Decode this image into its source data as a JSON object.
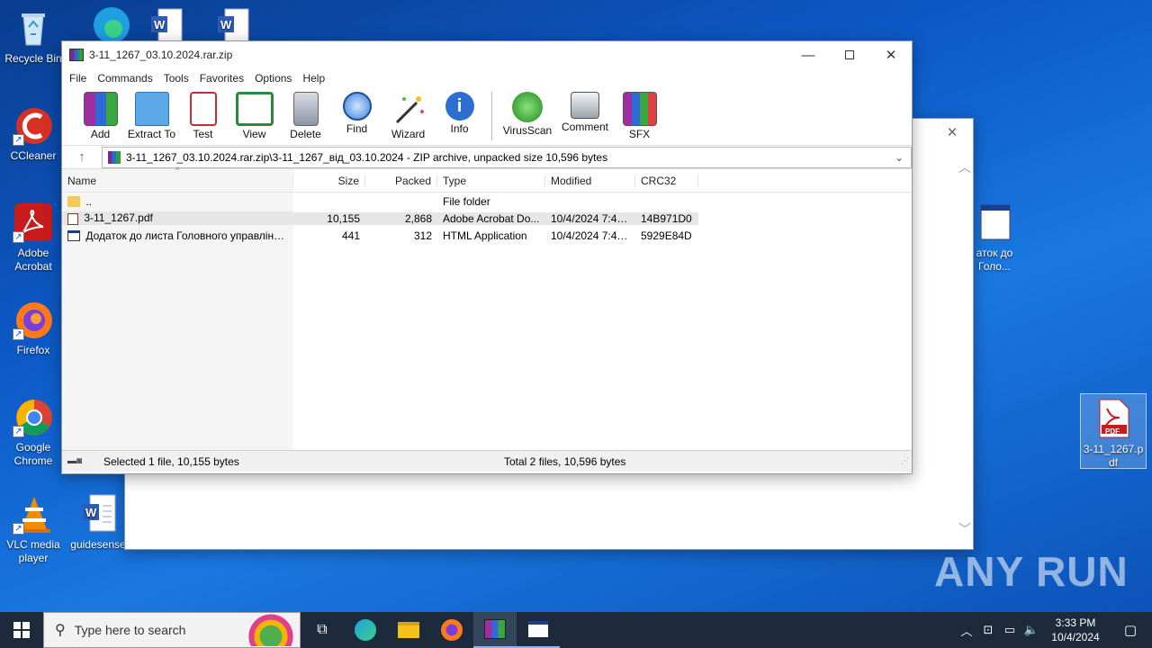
{
  "desktop": {
    "icons": [
      {
        "label": "Recycle Bin"
      },
      {
        "label": "CCleaner"
      },
      {
        "label": "Adobe Acrobat"
      },
      {
        "label": "Firefox"
      },
      {
        "label": "Google Chrome"
      },
      {
        "label": "VLC media player"
      },
      {
        "label": "guidesense"
      },
      {
        "label": "3-11_1267.pdf"
      },
      {
        "label": "аток до Голо..."
      }
    ],
    "pdf_icon_text": "PDF"
  },
  "bg_window": {
    "close_glyph": "✕"
  },
  "winrar": {
    "title": "3-11_1267_03.10.2024.rar.zip",
    "menu": [
      "File",
      "Commands",
      "Tools",
      "Favorites",
      "Options",
      "Help"
    ],
    "toolbar": [
      "Add",
      "Extract To",
      "Test",
      "View",
      "Delete",
      "Find",
      "Wizard",
      "Info",
      "VirusScan",
      "Comment",
      "SFX"
    ],
    "address": "3-11_1267_03.10.2024.rar.zip\\3-11_1267_від_03.10.2024 - ZIP archive, unpacked size 10,596 bytes",
    "columns": {
      "name": "Name",
      "size": "Size",
      "packed": "Packed",
      "type": "Type",
      "modified": "Modified",
      "crc": "CRC32"
    },
    "rows": [
      {
        "name": "..",
        "size": "",
        "packed": "",
        "type": "File folder",
        "modified": "",
        "crc": ""
      },
      {
        "name": "3-11_1267.pdf",
        "size": "10,155",
        "packed": "2,868",
        "type": "Adobe Acrobat Do...",
        "modified": "10/4/2024 7:48 ...",
        "crc": "14B971D0"
      },
      {
        "name": "Додаток до листа Головного управління...",
        "size": "441",
        "packed": "312",
        "type": "HTML Application",
        "modified": "10/4/2024 7:48 ...",
        "crc": "5929E84D"
      }
    ],
    "status_left": "Selected 1 file, 10,155 bytes",
    "status_right": "Total 2 files, 10,596 bytes"
  },
  "taskbar": {
    "search_placeholder": "Type here to search",
    "time": "3:33 PM",
    "date": "10/4/2024"
  },
  "watermark": "ANY RUN"
}
